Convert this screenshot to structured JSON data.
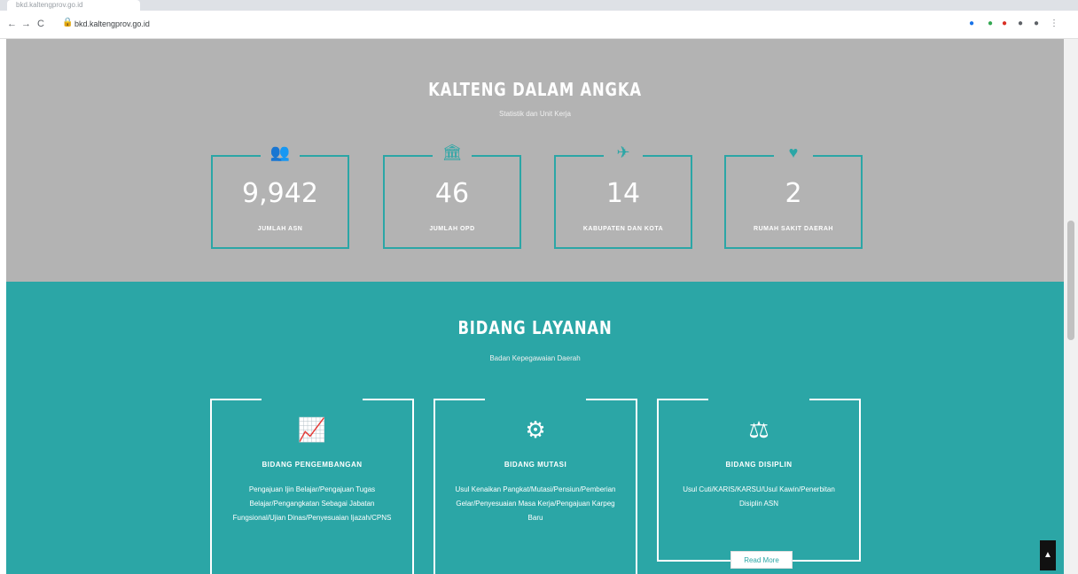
{
  "browser": {
    "tab_title": "bkd.kaltengprov.go.id",
    "back": "←",
    "forward": "→",
    "reload": "C",
    "lock": "🔒",
    "url": "bkd.kaltengprov.go.id",
    "extensions": [
      "●",
      "●",
      "●",
      "●",
      "●",
      "⋮"
    ]
  },
  "stats_section": {
    "title": "KALTENG DALAM ANGKA",
    "subtitle": "Statistik dan Unit Kerja",
    "items": [
      {
        "icon": "users-icon",
        "glyph": "👥",
        "number": "9,942",
        "label": "JUMLAH ASN"
      },
      {
        "icon": "building-icon",
        "glyph": "🏛",
        "number": "46",
        "label": "JUMLAH OPD"
      },
      {
        "icon": "plane-icon",
        "glyph": "✈",
        "number": "14",
        "label": "KABUPATEN DAN KOTA"
      },
      {
        "icon": "heartbeat-icon",
        "glyph": "♥",
        "number": "2",
        "label": "RUMAH SAKIT DAERAH"
      }
    ]
  },
  "services_section": {
    "title": "BIDANG LAYANAN",
    "subtitle": "Badan Kepegawaian Daerah",
    "items": [
      {
        "icon": "chart-line-icon",
        "glyph": "📈",
        "name": "BIDANG PENGEMBANGAN",
        "description": "Pengajuan Ijin Belajar/Pengajuan Tugas Belajar/Pengangkatan Sebagai Jabatan Fungsional/Ujian Dinas/Penyesuaian Ijazah/CPNS"
      },
      {
        "icon": "cogs-icon",
        "glyph": "⚙",
        "name": "BIDANG MUTASI",
        "description": "Usul Kenaikan Pangkat/Mutasi/Pensiun/Pemberian Gelar/Penyesuaian Masa Kerja/Pengajuan Karpeg Baru"
      },
      {
        "icon": "balance-scale-icon",
        "glyph": "⚖",
        "name": "BIDANG DISIPLIN",
        "description": "Usul Cuti/KARIS/KARSU/Usul Kawin/Penerbitan Disiplin ASN",
        "read_more": "Read More"
      }
    ]
  },
  "back_to_top": "▲",
  "colors": {
    "teal": "#2ba6a6",
    "grey": "#b3b3b3"
  }
}
